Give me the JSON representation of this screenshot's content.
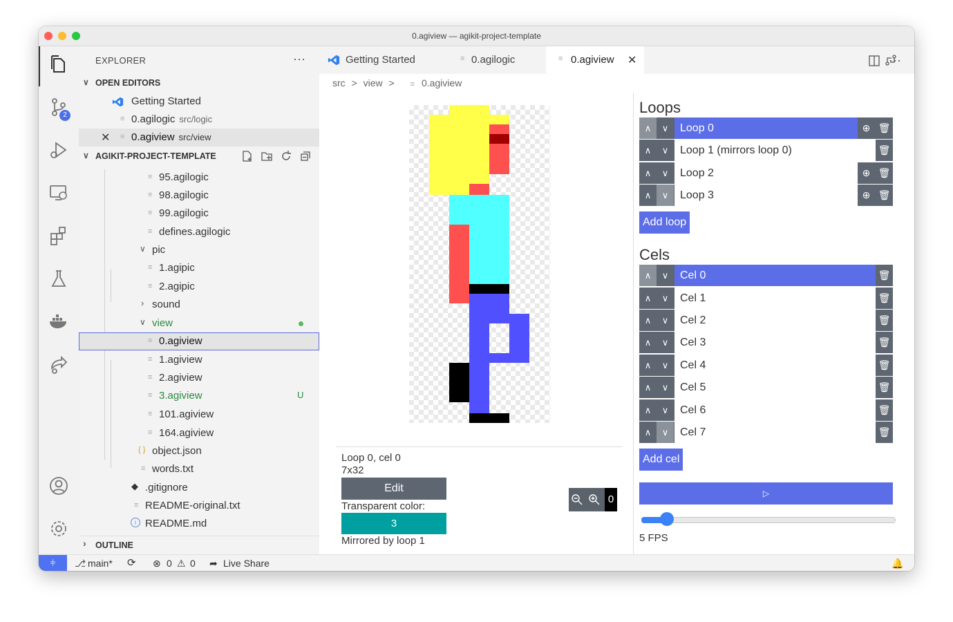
{
  "window": {
    "title": "0.agiview — agikit-project-template"
  },
  "activity_bar": {
    "scm_badge": "2"
  },
  "explorer": {
    "title": "EXPLORER",
    "more_label": "···",
    "open_editors": {
      "title": "OPEN EDITORS",
      "items": [
        {
          "name": "Getting Started",
          "path": ""
        },
        {
          "name": "0.agilogic",
          "path": "src/logic"
        },
        {
          "name": "0.agiview",
          "path": "src/view"
        }
      ]
    },
    "project": {
      "title": "AGIKIT-PROJECT-TEMPLATE",
      "tree": [
        {
          "label": "95.agilogic"
        },
        {
          "label": "98.agilogic"
        },
        {
          "label": "99.agilogic"
        },
        {
          "label": "defines.agilogic"
        },
        {
          "label": "pic"
        },
        {
          "label": "1.agipic"
        },
        {
          "label": "2.agipic"
        },
        {
          "label": "sound"
        },
        {
          "label": "view"
        },
        {
          "label": "0.agiview"
        },
        {
          "label": "1.agiview"
        },
        {
          "label": "2.agiview"
        },
        {
          "label": "3.agiview",
          "status": "U"
        },
        {
          "label": "101.agiview"
        },
        {
          "label": "164.agiview"
        },
        {
          "label": "object.json"
        },
        {
          "label": "words.txt"
        },
        {
          "label": ".gitignore"
        },
        {
          "label": "README-original.txt"
        },
        {
          "label": "README.md"
        }
      ]
    },
    "outline_title": "OUTLINE"
  },
  "tabs": [
    {
      "label": "Getting Started"
    },
    {
      "label": "0.agilogic"
    },
    {
      "label": "0.agiview",
      "active": true
    }
  ],
  "breadcrumb": {
    "parts": [
      "src",
      "view",
      "0.agiview"
    ],
    "sep": ">"
  },
  "view_editor": {
    "sprite_colors": {
      "yellow": "#ffff4a",
      "red": "#ff5050",
      "darkred": "#a00000",
      "cyan": "#50ffff",
      "blue": "#5050ff",
      "black": "#000000"
    },
    "info": {
      "loop_cel": "Loop 0, cel 0",
      "size": "7x32",
      "edit_label": "Edit",
      "transparent_label": "Transparent color:",
      "transparent_value": "3",
      "mirrored_text": "Mirrored by loop 1"
    },
    "zoom_value": "0",
    "loops": {
      "title": "Loops",
      "items": [
        {
          "label": "Loop 0"
        },
        {
          "label": "Loop 1 (mirrors loop 0)"
        },
        {
          "label": "Loop 2"
        },
        {
          "label": "Loop 3"
        }
      ],
      "add_label": "Add loop"
    },
    "cels": {
      "title": "Cels",
      "items": [
        {
          "label": "Cel 0"
        },
        {
          "label": "Cel 1"
        },
        {
          "label": "Cel 2"
        },
        {
          "label": "Cel 3"
        },
        {
          "label": "Cel 4"
        },
        {
          "label": "Cel 5"
        },
        {
          "label": "Cel 6"
        },
        {
          "label": "Cel 7"
        }
      ],
      "add_label": "Add cel"
    },
    "play_icon": "▷",
    "fps_label": "5 FPS",
    "fps_level": 0.1
  },
  "statusbar": {
    "branch": "main*",
    "errors": "0",
    "warnings": "0",
    "live_share": "Live Share"
  },
  "colors": {
    "accent": "#5b6ee8",
    "status_remote": "#4f72f0",
    "teal": "#00a0a0",
    "git_untracked": "#2b8a3e"
  }
}
